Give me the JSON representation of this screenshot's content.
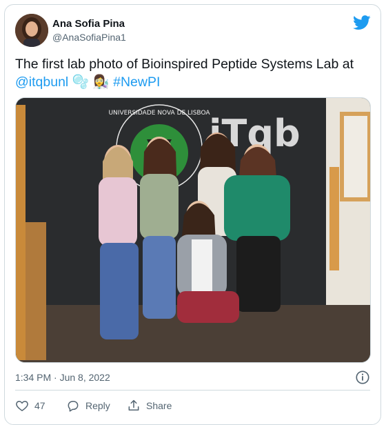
{
  "author": {
    "name": "Ana Sofia Pina",
    "handle": "@AnaSofiaPina1"
  },
  "tweet": {
    "text_main": "The first lab photo of Bioinspired Peptide Systems Lab at",
    "mention": "@itqbunl",
    "emoji": "🫧 👩‍🔬",
    "hashtag": "#NewPI"
  },
  "photo": {
    "wall_text": "UNIVERSIDADE NOVA DE LISBOA",
    "logo_text": "iTqb"
  },
  "meta": {
    "timestamp": "1:34 PM · Jun 8, 2022"
  },
  "actions": {
    "like_count": "47",
    "reply_label": "Reply",
    "share_label": "Share"
  },
  "colors": {
    "accent": "#1d9bf0",
    "secondary_text": "#536471",
    "border": "#cfd9de"
  },
  "icons": {
    "brand": "twitter-bird-icon",
    "info": "info-icon",
    "like": "heart-icon",
    "reply": "reply-icon",
    "share": "share-icon"
  }
}
